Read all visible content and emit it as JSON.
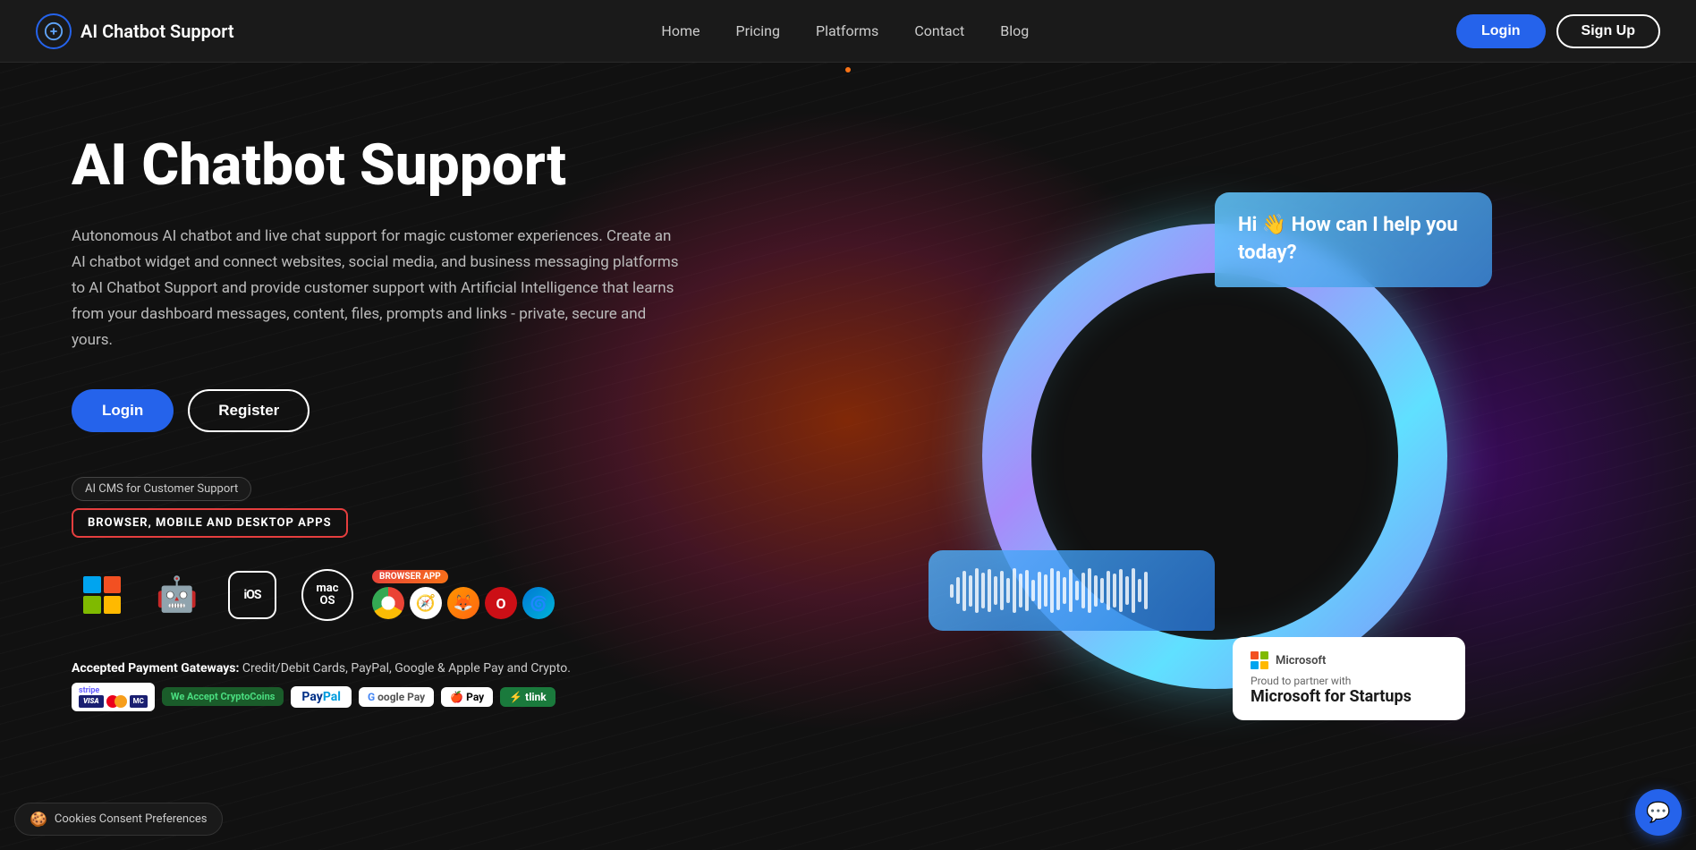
{
  "nav": {
    "logo_text": "AI Chatbot Support",
    "links": [
      {
        "label": "Home",
        "id": "home"
      },
      {
        "label": "Pricing",
        "id": "pricing"
      },
      {
        "label": "Platforms",
        "id": "platforms"
      },
      {
        "label": "Contact",
        "id": "contact"
      },
      {
        "label": "Blog",
        "id": "blog"
      }
    ],
    "login_label": "Login",
    "signup_label": "Sign Up"
  },
  "hero": {
    "title": "AI Chatbot Support",
    "description": "Autonomous AI chatbot and live chat support for magic customer experiences. Create an AI chatbot widget and connect websites, social media, and business messaging platforms to AI Chatbot Support and provide customer support with Artificial Intelligence that learns from your dashboard messages, content, files, prompts and links - private, secure and yours.",
    "login_btn": "Login",
    "register_btn": "Register",
    "badge_cms": "AI CMS for Customer Support",
    "badge_platforms": "BROWSER, MOBILE AND DESKTOP APPS",
    "chat_bubble_text": "Hi 👋 How can I help you today?",
    "ms_partner_label": "Proud to partner with",
    "ms_startup_text": "Microsoft for Startups",
    "ms_logo_text": "Microsoft",
    "payment_label": "Accepted Payment Gateways:",
    "payment_desc": "Credit/Debit Cards, PayPal, Google & Apple Pay and Crypto.",
    "platforms": [
      {
        "id": "windows",
        "label": "Windows"
      },
      {
        "id": "android",
        "label": "Android"
      },
      {
        "id": "ios",
        "label": "iOS"
      },
      {
        "id": "macos",
        "label": "macOS"
      },
      {
        "id": "browser",
        "label": "Browser App"
      }
    ],
    "browsers": [
      "Chrome",
      "Safari",
      "Firefox",
      "Opera",
      "Edge"
    ]
  },
  "cookie": {
    "text": "Cookies Consent Preferences"
  },
  "wave_bars": [
    15,
    30,
    45,
    35,
    50,
    40,
    48,
    32,
    44,
    28,
    50,
    38,
    46,
    24,
    42,
    36,
    50,
    44,
    30,
    48,
    22,
    40,
    50,
    35,
    28,
    44,
    38,
    48,
    32,
    50,
    26,
    42
  ]
}
